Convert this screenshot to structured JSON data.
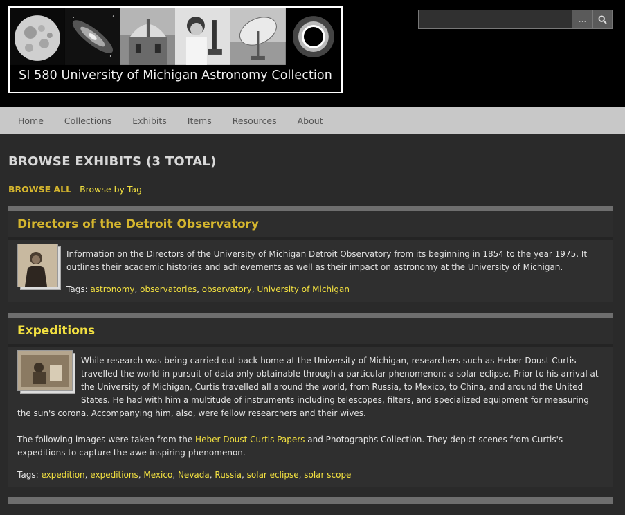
{
  "site": {
    "title": "SI 580 University of Michigan Astronomy Collection"
  },
  "search": {
    "placeholder": "",
    "advanced_label": "..."
  },
  "nav": {
    "items": [
      "Home",
      "Collections",
      "Exhibits",
      "Items",
      "Resources",
      "About"
    ]
  },
  "page": {
    "title": "BROWSE EXHIBITS (3 TOTAL)",
    "browse_all": "BROWSE ALL",
    "browse_by_tag": "Browse by Tag"
  },
  "exhibits": [
    {
      "title": "Directors of the Detroit Observatory",
      "description": "Information on the Directors of the University of Michigan Detroit Observatory from its beginning in 1854 to the year 1975. It outlines their academic histories and achievements as well as their impact on astronomy at the University of Michigan.",
      "tags_label": "Tags:",
      "tags": [
        "astronomy",
        "observatories",
        "observatory",
        "University of Michigan"
      ]
    },
    {
      "title": "Expeditions",
      "description": "While research was being carried out back home at the University of Michigan, researchers such as Heber Doust Curtis travelled the world in pursuit of data only obtainable through a particular phenomenon: a solar eclipse. Prior to his arrival at the University of Michigan, Curtis travelled all around the world, from Russia, to Mexico, to China, and around the United States. He had with him a multitude of instruments including telescopes, filters, and specialized equipment for measuring the sun's corona. Accompanying him, also, were fellow researchers and their wives.",
      "para2_pre": "The following images were taken from the ",
      "para2_link": "Heber Doust Curtis Papers",
      "para2_post": " and Photographs Collection. They depict scenes from Curtis's expeditions to capture the awe-inspiring phenomenon.",
      "tags_label": "Tags:",
      "tags": [
        "expedition",
        "expeditions",
        "Mexico",
        "Nevada",
        "Russia",
        "solar eclipse",
        "solar scope"
      ]
    }
  ],
  "colors": {
    "accent": "#d4b52e",
    "link": "#f2e040",
    "background": "#2a2a2a",
    "nav_bg": "#c8c8c8"
  },
  "icons": {
    "search": "magnifier-icon",
    "banner_tiles": [
      "moon-icon",
      "galaxy-icon",
      "observatory-dome-icon",
      "scientist-microscope-icon",
      "radio-telescope-icon",
      "solar-eclipse-icon"
    ]
  }
}
